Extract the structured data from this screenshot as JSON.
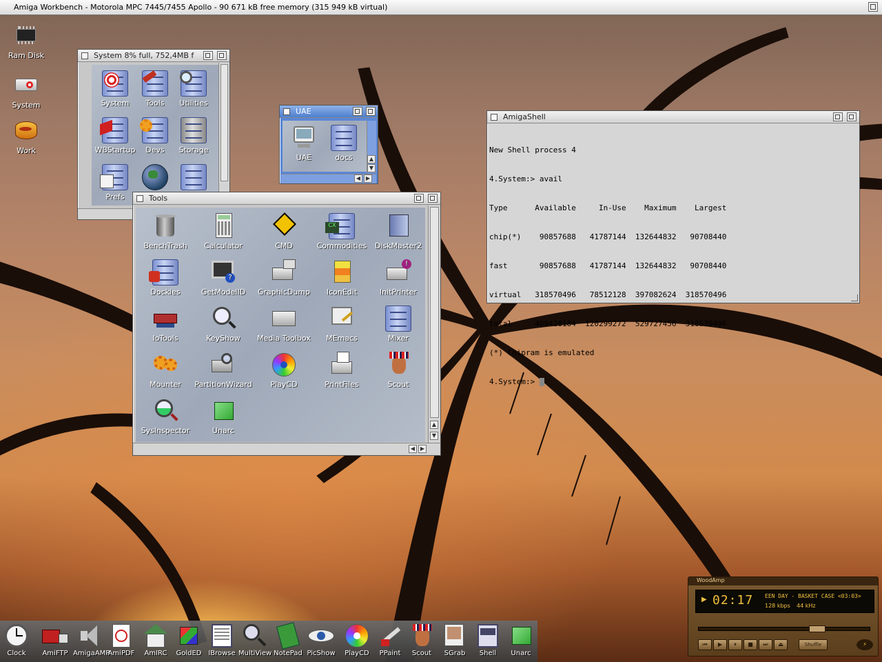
{
  "screen_title": "Amiga Workbench - Motorola MPC 7445/7455 Apollo - 90 671 kB free memory (315 949 kB virtual)",
  "desktop_icons": [
    {
      "label": "Ram Disk",
      "icon": "ram-chip-icon"
    },
    {
      "label": "System",
      "icon": "floppy-drive-icon"
    },
    {
      "label": "Work",
      "icon": "hard-disk-icon"
    }
  ],
  "system_window": {
    "title": "System  8% full, 752,4MB f",
    "icons": [
      "System",
      "Tools",
      "Utilities",
      "WBStartup",
      "Devs",
      "Storage",
      "Prefs",
      "",
      ""
    ]
  },
  "uae_window": {
    "title": "UAE",
    "icons": [
      "UAE",
      "docs"
    ]
  },
  "tools_window": {
    "title": "Tools",
    "icons": [
      "BenchTrash",
      "Calculator",
      "CMD",
      "Commodities",
      "DiskMaster2",
      "Dockies",
      "GetModelID",
      "GraphicDump",
      "IconEdit",
      "InitPrinter",
      "IoTools",
      "KeyShow",
      "Media Toolbox",
      "MEmacs",
      "Mixer",
      "Mounter",
      "PartitionWizard",
      "PlayCD",
      "PrintFiles",
      "Scout",
      "SysInspector",
      "Unarc"
    ]
  },
  "shell_window": {
    "title": "AmigaShell",
    "lines": [
      "New Shell process 4",
      "4.System:> avail",
      "Type      Available     In-Use    Maximum    Largest",
      "chip(*)    90857688   41787144  132644832   90708440",
      "fast       90857688   41787144  132644832   90708440",
      "virtual   318570496   78512128  397082624  318570496",
      "total     409428184  120299272  529727456  318570496",
      "(*) Chipram is emulated",
      "4.System:> "
    ]
  },
  "dock": [
    "Clock",
    "AmiFTP",
    "AmigaAMP",
    "AmiPDF",
    "AmIRC",
    "GoldED",
    "IBrowse",
    "MultiView",
    "NotePad",
    "PicShow",
    "PlayCD",
    "PPaint",
    "Scout",
    "SGrab",
    "Shell",
    "Unarc"
  ],
  "woodamp": {
    "title": "WoodAmp",
    "time": "02:17",
    "song": "EEN DAY - BASKET CASE <03:03>",
    "bitrate": "128 kbps",
    "freq": "44 kHz",
    "shuffle": "Shuffle"
  }
}
